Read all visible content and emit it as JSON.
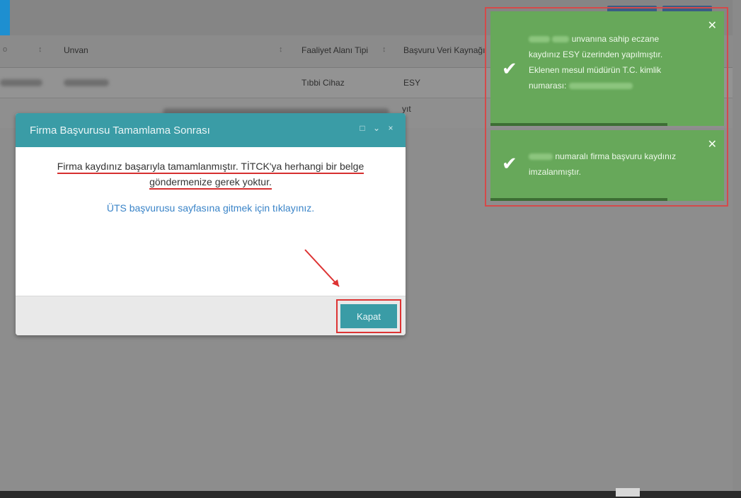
{
  "grid": {
    "headers": [
      "Unvan",
      "Faaliyet Alanı Tipi",
      "Başvuru Veri Kaynağı"
    ],
    "row1": {
      "faaliyet": "Tıbbi Cihaz",
      "kaynak": "ESY"
    },
    "row2_tail": "yıt"
  },
  "modal": {
    "title": "Firma Başvurusu Tamamlama Sonrası",
    "message_line1": "Firma kaydınız başarıyla tamamlanmıştır. TİTCK'ya herhangi bir belge",
    "message_line2": "göndermenize gerek yoktur.",
    "link_text": "ÜTS başvurusu sayfasına gitmek için tıklayınız.",
    "close_button": "Kapat"
  },
  "toasts": [
    {
      "lines": [
        "unvanına sahip eczane",
        "kaydınız ESY üzerinden yapılmıştır.",
        "Eklenen mesul müdürün T.C. kimlik",
        "numarası:"
      ]
    },
    {
      "lines": [
        "numaralı firma başvuru kaydınız",
        "imzalanmıştır."
      ]
    }
  ],
  "icons": {
    "check": "check-icon",
    "close": "close-icon"
  },
  "colors": {
    "modal_header": "#3a9ca6",
    "toast_bg": "#67a85a",
    "highlight": "#d33"
  }
}
